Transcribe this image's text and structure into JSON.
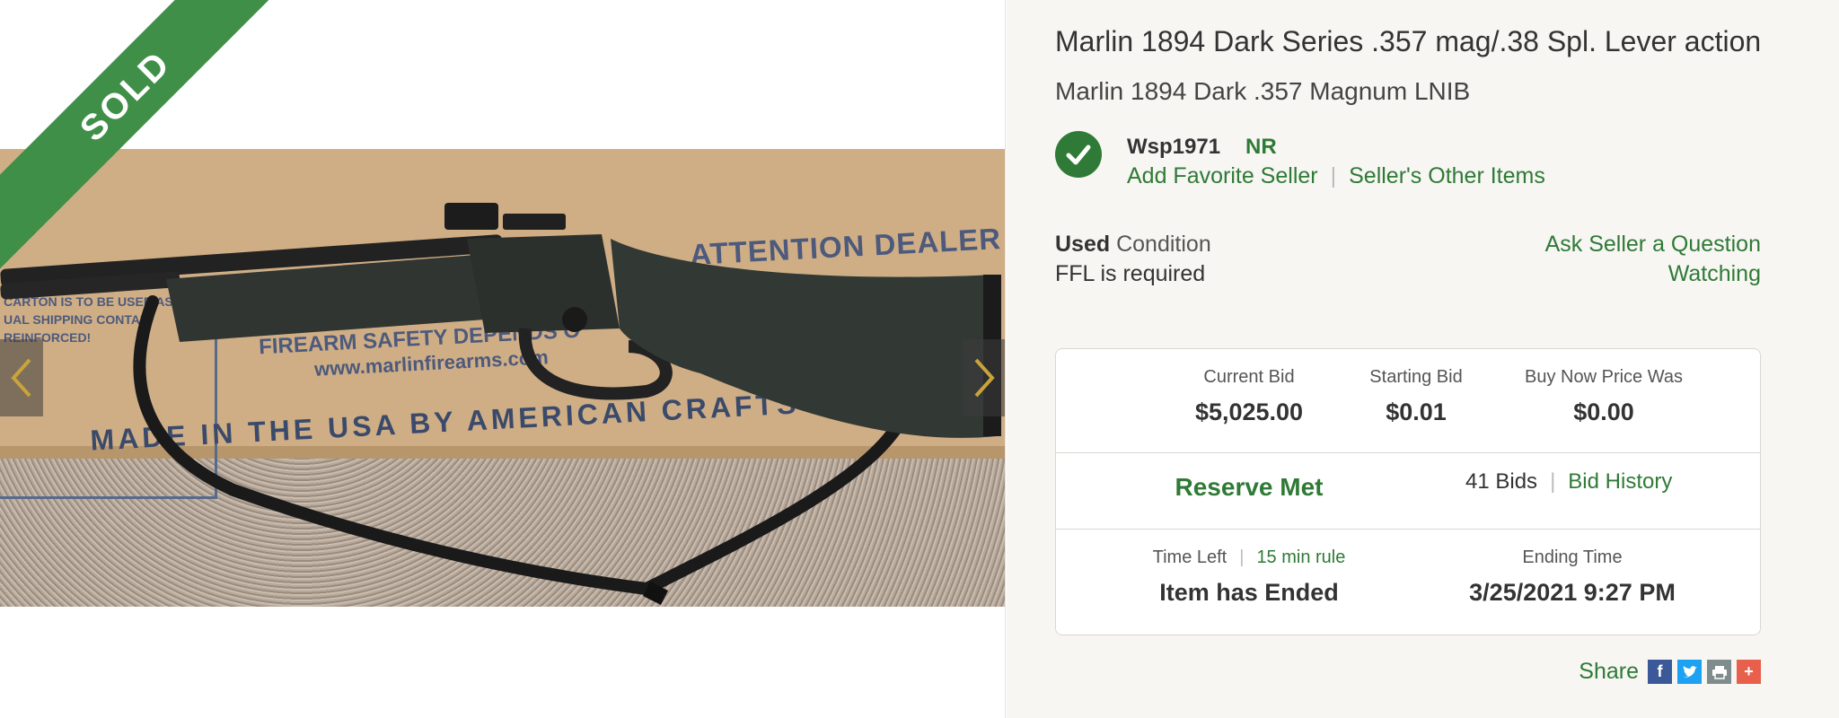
{
  "gallery": {
    "sold_label": "SOLD",
    "box_text": {
      "attention": "ATTENTION DEALER",
      "safety": "FIREARM SAFETY DEPENDS O",
      "website": "www.marlinfirearms.com",
      "made_in": "MADE IN THE USA BY AMERICAN CRAFTS",
      "small_lines": [
        "CARTON IS TO BE USED AS",
        "UAL SHIPPING CONTAI",
        "REINFORCED!"
      ]
    }
  },
  "listing": {
    "title": "Marlin 1894 Dark Series .357 mag/.38 Spl. Lever action",
    "subtitle": "Marlin 1894 Dark .357 Magnum LNIB"
  },
  "seller": {
    "name": "Wsp1971",
    "badge": "NR",
    "add_favorite": "Add Favorite Seller",
    "other_items": "Seller's Other Items"
  },
  "condition": {
    "value": "Used",
    "label": "Condition",
    "ffl": "FFL is required"
  },
  "actions": {
    "ask_question": "Ask Seller a Question",
    "watching": "Watching"
  },
  "bidding": {
    "current_bid_label": "Current Bid",
    "current_bid": "$5,025.00",
    "starting_bid_label": "Starting Bid",
    "starting_bid": "$0.01",
    "buy_now_label": "Buy Now Price Was",
    "buy_now": "$0.00",
    "reserve": "Reserve Met",
    "bid_count": "41 Bids",
    "bid_history": "Bid History",
    "time_left_label": "Time Left",
    "rule_link": "15 min rule",
    "time_left": "Item has Ended",
    "ending_time_label": "Ending Time",
    "ending_time": "3/25/2021 9:27 PM"
  },
  "share": {
    "label": "Share",
    "icons": [
      "facebook-icon",
      "twitter-icon",
      "print-icon",
      "plus-icon"
    ]
  },
  "colors": {
    "accent": "#2f7a36",
    "ribbon": "#3f8f48",
    "panel_bg": "#f7f6f3"
  }
}
